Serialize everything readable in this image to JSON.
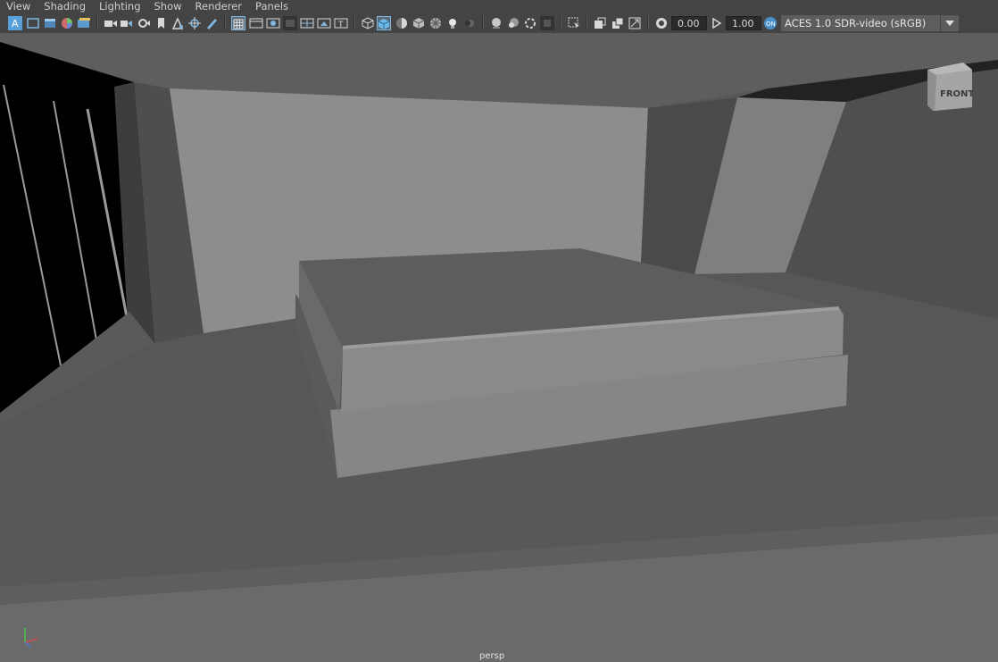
{
  "menu": {
    "items": [
      {
        "label": "View"
      },
      {
        "label": "Shading"
      },
      {
        "label": "Lighting"
      },
      {
        "label": "Show"
      },
      {
        "label": "Renderer"
      },
      {
        "label": "Panels"
      }
    ]
  },
  "toolbar": {
    "exposure_value": "0.00",
    "gamma_value": "1.00",
    "color_space": "ACES 1.0 SDR-video (sRGB)",
    "icons": [
      "select-camera-icon",
      "camera-attributes-icon",
      "bookmark-icon",
      "image-plane-icon",
      "grease-pencil-icon",
      "2d-pan-zoom-icon",
      "grid-icon",
      "film-gate-icon",
      "resolution-gate-icon",
      "gate-mask-icon",
      "field-chart-icon",
      "safe-action-icon",
      "safe-title-icon",
      "wireframe-icon",
      "smooth-shade-icon",
      "default-material-icon",
      "textured-icon",
      "xray-icon",
      "use-all-lights-icon",
      "shadows-icon",
      "isolate-select-icon",
      "exposure-icon",
      "gamma-icon",
      "color-management-icon"
    ]
  },
  "viewport": {
    "camera_label": "persp",
    "view_cube_label": "FRONT"
  }
}
